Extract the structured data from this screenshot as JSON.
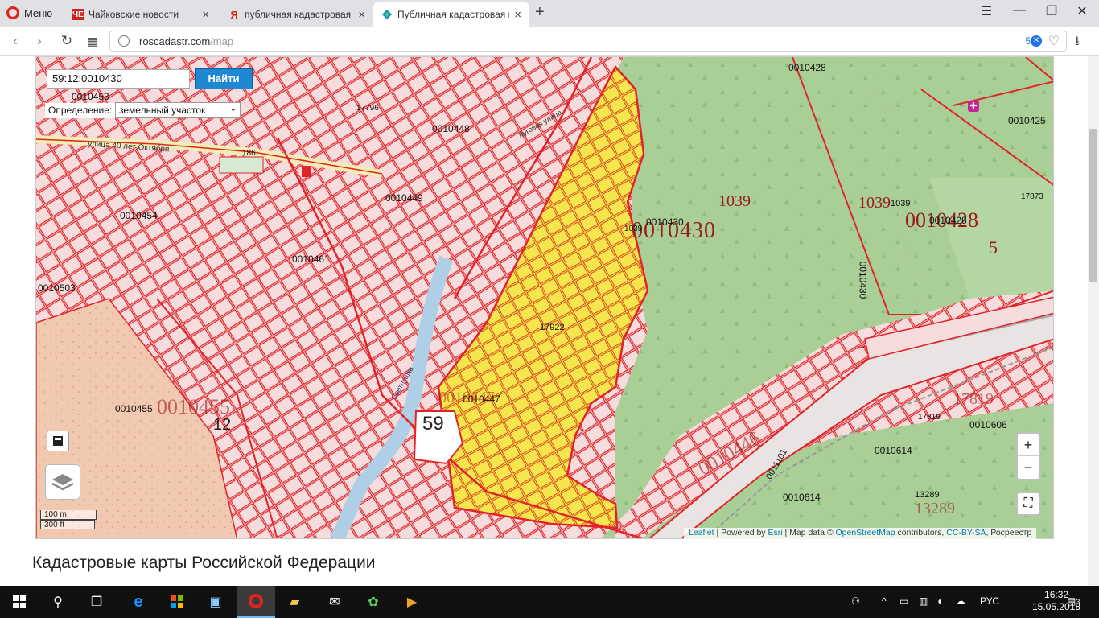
{
  "browser": {
    "menu_label": "Меню",
    "tabs": [
      {
        "icon": "chaikovskie-novosti-icon",
        "title": "Чайковские новости",
        "favicon_text": "ЧЕ",
        "favicon_color": "#d21f1f"
      },
      {
        "icon": "yandex-icon",
        "title": "публичная кадастровая к",
        "favicon_text": "Я",
        "favicon_color": "#ffffff"
      },
      {
        "icon": "rosreestr-icon",
        "title": "Публичная кадастровая к",
        "favicon_text": "",
        "favicon_color": "#1c8adb"
      }
    ],
    "url_domain": "roscadastr.com",
    "url_path": "/map",
    "adblock_count": "5"
  },
  "map": {
    "search_value": "59:12:0010430",
    "search_button": "Найти",
    "definition_label": "Определение:",
    "definition_value": "земельный участок",
    "zoom_in": "+",
    "zoom_out": "−",
    "scale_metric": "100 m",
    "scale_imperial": "300 ft",
    "attribution": {
      "leaflet": "Leaflet",
      "powered_by": "| Powered by",
      "esri": "Esri",
      "map_data": "| Map data ©",
      "osm": "OpenStreetMap",
      "contributors": "contributors,",
      "license": "CC-BY-SA",
      "rosreestr": ", Росреестр"
    },
    "labels": {
      "q0010430_big": "0010430",
      "q0010430_small": "0010430",
      "q0010428_top": "0010428",
      "q0010428_mid": "0010428",
      "q0010448": "0010448",
      "q0010449": "0010449",
      "q0010454": "0010454",
      "q0010461": "0010461",
      "q0010453": "0010453",
      "q0010503": "0010503",
      "q0010455": "0010455",
      "q0010447": "0010447",
      "q0010425": "0010425",
      "q0010606": "0010606",
      "q0010614a": "0010614",
      "q0010614b": "0010614",
      "q0010446": "0010446",
      "q0010430_side": "0010430",
      "n1039a": "1039",
      "n1039b": "1039",
      "n1039c": "1039",
      "n1039d": "1039",
      "n17922": "17922",
      "n17819a": "17819",
      "n17819b": "17819",
      "n17873": "17873",
      "n13289a": "13289",
      "n13289b": "13289",
      "n59": "59",
      "n12": "12",
      "n5": "5",
      "n186": "186",
      "n17796": "17796",
      "street1": "улица 40 лет Октября",
      "street2": "Луговая улица",
      "river": "Светлушка",
      "road1": "0011101"
    }
  },
  "page": {
    "heading": "Кадастровые карты Российской Федерации"
  },
  "taskbar": {
    "language": "РУС",
    "time": "16:32",
    "date": "15.05.2018",
    "notifications": "3"
  }
}
